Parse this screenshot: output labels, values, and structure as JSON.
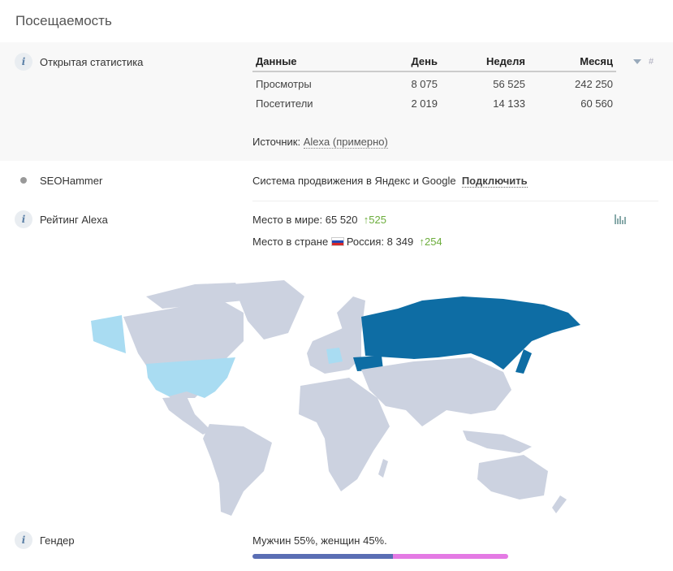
{
  "page_title": "Посещаемость",
  "open_stats": {
    "label": "Открытая статистика",
    "headers": [
      "Данные",
      "День",
      "Неделя",
      "Месяц"
    ],
    "rows": [
      [
        "Просмотры",
        "8 075",
        "56 525",
        "242 250"
      ],
      [
        "Посетители",
        "2 019",
        "14 133",
        "60 560"
      ]
    ],
    "source_label": "Источник:",
    "source_link": "Alexa (примерно)",
    "hash": "#"
  },
  "seohammer": {
    "label": "SEOHammer",
    "description": "Система продвижения в Яндекс и Google",
    "connect": "Подключить"
  },
  "alexa": {
    "label": "Рейтинг Alexa",
    "world_label": "Место в мире: 65 520",
    "world_change": "525",
    "country_prefix": "Место в стране",
    "country_name": "Россия: 8 349",
    "country_change": "254",
    "map_highlight_colors": {
      "russia": "#0e6da4",
      "usa_alaska_germany": "#a9dcf2",
      "other": "#ccd2e0"
    }
  },
  "gender": {
    "label": "Гендер",
    "text": "Мужчин 55%, женщин 45%.",
    "male_fraction": 0.55,
    "female_fraction": 0.45,
    "male_color": "#5a6eb4",
    "female_color": "#e47ae4"
  }
}
